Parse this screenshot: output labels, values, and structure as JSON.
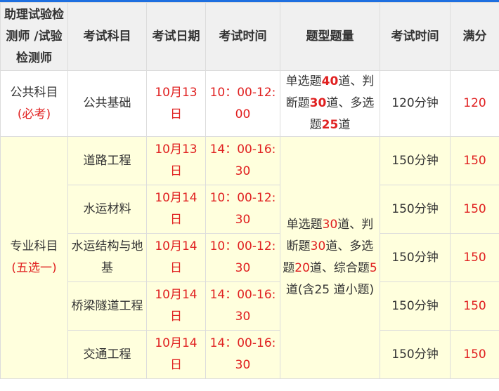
{
  "header": {
    "col1": "助理试验检测师 /试验检测师",
    "col2": "考试科目",
    "col3": "考试日期",
    "col4": "考试时间",
    "col5": "题型题量",
    "col6": "考试时间",
    "col7": "满分"
  },
  "public": {
    "group_label": "公共科目",
    "group_note": "(必考)",
    "subject": "公共基础",
    "date": "10月13日",
    "time": "10：00-12:00",
    "qtype": {
      "p1": "单选题",
      "n1": "40",
      "p2": "道、判断题",
      "n2": "30",
      "p3": "道、多选题",
      "n3": "25",
      "p4": "道"
    },
    "duration": "120分钟",
    "score": "120"
  },
  "major": {
    "group_label": "专业科目",
    "group_note": "(五选一)",
    "qtype": {
      "p1": "单选题",
      "n1": "30",
      "p2": "道、判断题",
      "n2": "30",
      "p3": "道、多选题",
      "n3": "20",
      "p4": "道、综合题",
      "n4": "5",
      "p5": "道(含25 道小题)"
    },
    "rows": [
      {
        "subject": "道路工程",
        "date": "10月13日",
        "time": "14：00-16:30",
        "duration": "150分钟",
        "score": "150"
      },
      {
        "subject": "水运材料",
        "date": "10月14日",
        "time": "10：00-12:30",
        "duration": "150分钟",
        "score": "150"
      },
      {
        "subject": "水运结构与地基",
        "date": "10月14日",
        "time": "10：00-12:30",
        "duration": "150分钟",
        "score": "150"
      },
      {
        "subject": "桥梁隧道工程",
        "date": "10月14日",
        "time": "14：00-16:30",
        "duration": "150分钟",
        "score": "150"
      },
      {
        "subject": "交通工程",
        "date": "10月14日",
        "time": "14：00-16:30",
        "duration": "150分钟",
        "score": "150"
      }
    ]
  }
}
